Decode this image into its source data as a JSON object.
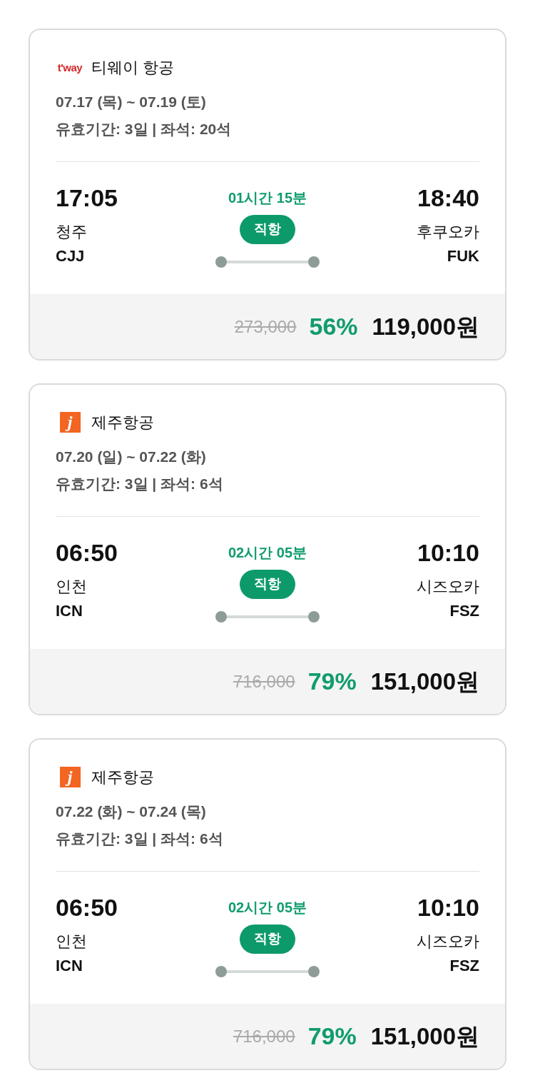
{
  "flights": [
    {
      "airline": {
        "logo": {
          "kind": "tway",
          "text": "t'way"
        },
        "name": "티웨이 항공"
      },
      "dates": "07.17 (목) ~ 07.19 (토)",
      "details": "유효기간: 3일 | 좌석: 20석",
      "departure": {
        "time": "17:05",
        "city": "청주",
        "code": "CJJ"
      },
      "duration": "01시간 15분",
      "route_type": "직항",
      "arrival": {
        "time": "18:40",
        "city": "후쿠오카",
        "code": "FUK"
      },
      "price": {
        "original": "273,000",
        "discount": "56%",
        "final": "119,000원"
      }
    },
    {
      "airline": {
        "logo": {
          "kind": "jeju",
          "text": "j"
        },
        "name": "제주항공"
      },
      "dates": "07.20 (일) ~ 07.22 (화)",
      "details": "유효기간: 3일 | 좌석: 6석",
      "departure": {
        "time": "06:50",
        "city": "인천",
        "code": "ICN"
      },
      "duration": "02시간 05분",
      "route_type": "직항",
      "arrival": {
        "time": "10:10",
        "city": "시즈오카",
        "code": "FSZ"
      },
      "price": {
        "original": "716,000",
        "discount": "79%",
        "final": "151,000원"
      }
    },
    {
      "airline": {
        "logo": {
          "kind": "jeju",
          "text": "j"
        },
        "name": "제주항공"
      },
      "dates": "07.22 (화) ~ 07.24 (목)",
      "details": "유효기간: 3일 | 좌석: 6석",
      "departure": {
        "time": "06:50",
        "city": "인천",
        "code": "ICN"
      },
      "duration": "02시간 05분",
      "route_type": "직항",
      "arrival": {
        "time": "10:10",
        "city": "시즈오카",
        "code": "FSZ"
      },
      "price": {
        "original": "716,000",
        "discount": "79%",
        "final": "151,000원"
      }
    }
  ]
}
